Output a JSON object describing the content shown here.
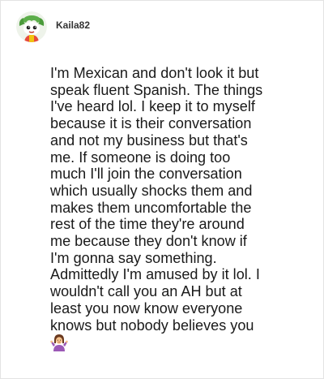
{
  "comment": {
    "author": "Kaila82",
    "avatar_icon": "green-cartoon-creature-avatar",
    "text": "I'm Mexican and don't look it but\nspeak fluent Spanish. The things\nI've heard lol. I keep it to myself\nbecause it is their conversation\nand not my business but that's\nme. If someone is doing too\nmuch I'll join the conversation\nwhich usually shocks them and\nmakes them uncomfortable the\nrest of the time they're around\nme because they don't know if\nI'm gonna say something.\nAdmittedly I'm amused by it lol. I\nwouldn't call you an AH but at\nleast you now know everyone\nknows but nobody believes you",
    "trailing_emoji": "person-shrugging-icon"
  },
  "colors": {
    "text": "#1a1a1a",
    "author": "#333333",
    "border": "#e3e3e3",
    "avatar_green": "#5cae4a"
  }
}
